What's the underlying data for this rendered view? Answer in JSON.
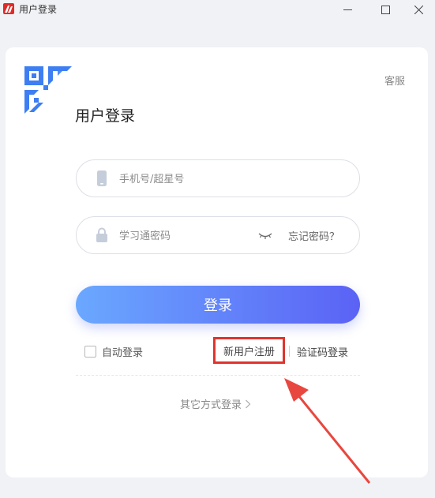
{
  "window": {
    "title": "用户登录",
    "icons": [
      "app-logo-icon",
      "minimize-icon",
      "maximize-icon",
      "close-icon"
    ]
  },
  "card": {
    "service_label": "客服",
    "title": "用户登录",
    "qr_icon": "qr-code-icon"
  },
  "form": {
    "phone": {
      "placeholder": "手机号/超星号",
      "value": "",
      "icon": "phone-icon"
    },
    "password": {
      "placeholder": "学习通密码",
      "value": "",
      "icon": "lock-icon",
      "eye_icon": "eye-closed-icon"
    },
    "forgot_label": "忘记密码？",
    "login_label": "登录",
    "auto_login_label": "自动登录",
    "auto_login_checked": false,
    "register_label": "新用户注册",
    "sms_login_label": "验证码登录",
    "other_login_label": "其它方式登录"
  },
  "colors": {
    "primary_start": "#6aa8ff",
    "primary_end": "#5b62f5",
    "qr_blue": "#3d7ef2",
    "annotation_red": "#e0342e"
  }
}
